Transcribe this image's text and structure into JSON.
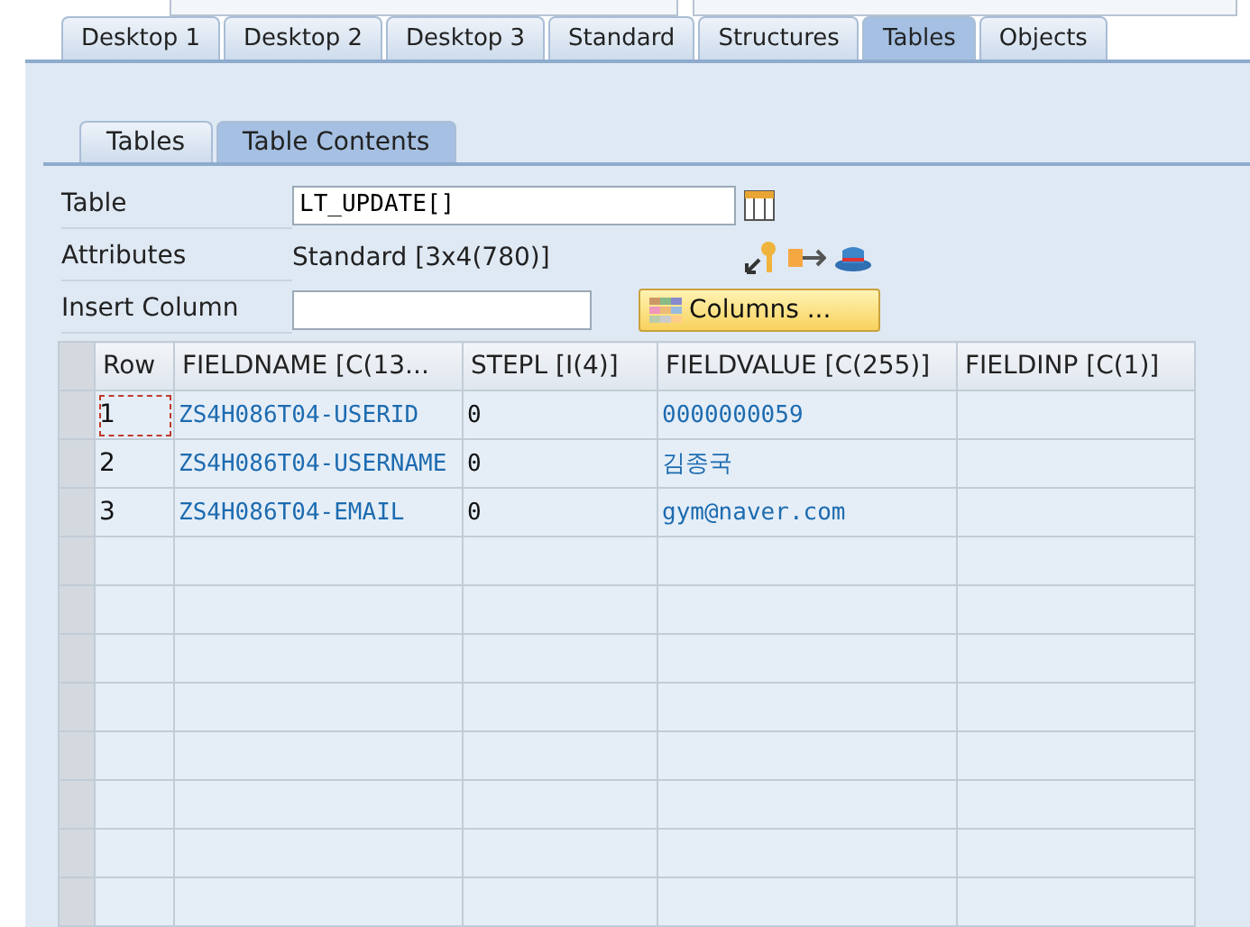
{
  "desktop_tabs": [
    {
      "label": "Desktop 1",
      "selected": false
    },
    {
      "label": "Desktop 2",
      "selected": false
    },
    {
      "label": "Desktop 3",
      "selected": false
    },
    {
      "label": "Standard",
      "selected": false
    },
    {
      "label": "Structures",
      "selected": false
    },
    {
      "label": "Tables",
      "selected": true
    },
    {
      "label": "Objects",
      "selected": false
    }
  ],
  "sub_tabs": [
    {
      "label": "Tables",
      "selected": false
    },
    {
      "label": "Table Contents",
      "selected": true
    }
  ],
  "form": {
    "table_label": "Table",
    "table_value": "LT_UPDATE[]",
    "attributes_label": "Attributes",
    "attributes_value": "Standard [3x4(780)]",
    "insert_label": "Insert Column",
    "columns_button": "Columns ..."
  },
  "table": {
    "columns": [
      "Row",
      "FIELDNAME [C(13...",
      "STEPL [I(4)]",
      "FIELDVALUE [C(255)]",
      "FIELDINP [C(1)]"
    ],
    "rows": [
      {
        "cells": [
          "1",
          "ZS4H086T04-USERID",
          "0",
          "0000000059",
          ""
        ],
        "selected": true
      },
      {
        "cells": [
          "2",
          "ZS4H086T04-USERNAME",
          "0",
          "김종국",
          ""
        ],
        "selected": false
      },
      {
        "cells": [
          "3",
          "ZS4H086T04-EMAIL",
          "0",
          "gym@naver.com",
          ""
        ],
        "selected": false
      }
    ]
  }
}
